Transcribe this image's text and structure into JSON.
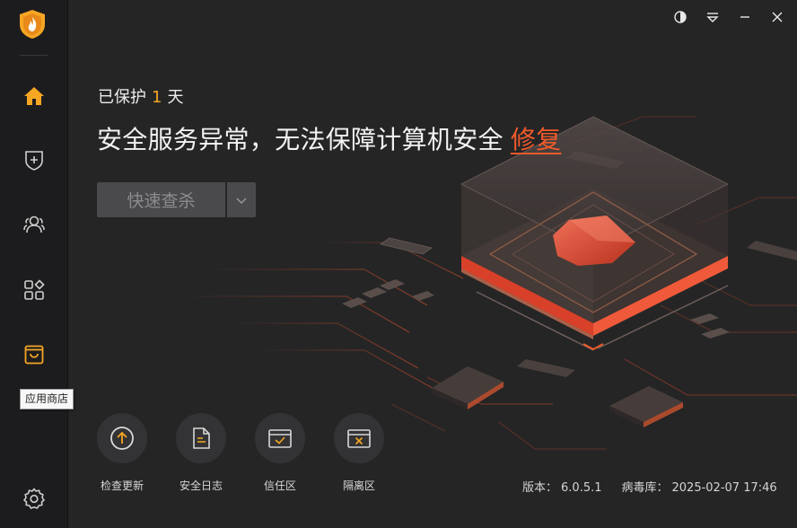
{
  "sidebar": {
    "logo_icon": "flame-shield-logo",
    "items": [
      {
        "icon": "home-icon"
      },
      {
        "icon": "shield-plus-icon"
      },
      {
        "icon": "users-icon"
      },
      {
        "icon": "apps-grid-icon"
      },
      {
        "icon": "store-icon",
        "tooltip": "应用商店"
      },
      {
        "icon": "settings-icon"
      }
    ]
  },
  "window_controls": [
    "theme-icon",
    "menu-icon",
    "minimize-icon",
    "close-icon"
  ],
  "status": {
    "protected_prefix": "已保护",
    "protected_days": "1",
    "protected_suffix": "天",
    "alert_text": "安全服务异常，无法保障计算机安全",
    "fix_link": "修复"
  },
  "scan": {
    "label": "快速查杀"
  },
  "tools": [
    {
      "label": "检查更新",
      "icon": "update-icon"
    },
    {
      "label": "安全日志",
      "icon": "log-icon"
    },
    {
      "label": "信任区",
      "icon": "trust-zone-icon"
    },
    {
      "label": "隔离区",
      "icon": "quarantine-icon"
    }
  ],
  "footer": {
    "version_label": "版本：",
    "version_value": "6.0.5.1",
    "virus_db_label": "病毒库：",
    "virus_db_value": "2025-02-07 17:46"
  },
  "colors": {
    "accent_orange": "#f5a623",
    "alert_red": "#f05a2a",
    "sidebar_bg": "#1c1c1e",
    "main_bg": "#252526"
  }
}
